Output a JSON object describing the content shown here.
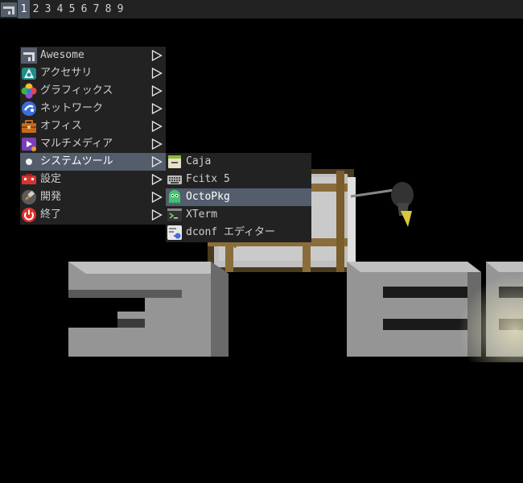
{
  "tags": [
    "1",
    "2",
    "3",
    "4",
    "5",
    "6",
    "7",
    "8",
    "9"
  ],
  "focused_tag": "1",
  "main_menu": [
    {
      "label": "Awesome",
      "icon": "awesome-icon",
      "submenu": true
    },
    {
      "label": "アクセサリ",
      "icon": "accessories-icon",
      "submenu": true
    },
    {
      "label": "グラフィックス",
      "icon": "graphics-icon",
      "submenu": true
    },
    {
      "label": "ネットワーク",
      "icon": "network-icon",
      "submenu": true
    },
    {
      "label": "オフィス",
      "icon": "office-icon",
      "submenu": true
    },
    {
      "label": "マルチメディア",
      "icon": "multimedia-icon",
      "submenu": true
    },
    {
      "label": "システムツール",
      "icon": "system-tools-icon",
      "submenu": true,
      "selected": true
    },
    {
      "label": "設定",
      "icon": "settings-icon",
      "submenu": true
    },
    {
      "label": "開発",
      "icon": "development-icon",
      "submenu": true
    },
    {
      "label": "終了",
      "icon": "power-icon",
      "submenu": true
    }
  ],
  "sub_menu": [
    {
      "label": "Caja",
      "icon": "file-manager-icon"
    },
    {
      "label": "Fcitx 5",
      "icon": "keyboard-icon"
    },
    {
      "label": "OctoPkg",
      "icon": "octopkg-icon",
      "selected": true
    },
    {
      "label": "XTerm",
      "icon": "terminal-icon"
    },
    {
      "label": "dconf エディター",
      "icon": "dconf-editor-icon"
    }
  ],
  "colors": {
    "bar_bg": "#222222",
    "focus_bg": "#535d6c",
    "text": "#cfcfcf"
  }
}
